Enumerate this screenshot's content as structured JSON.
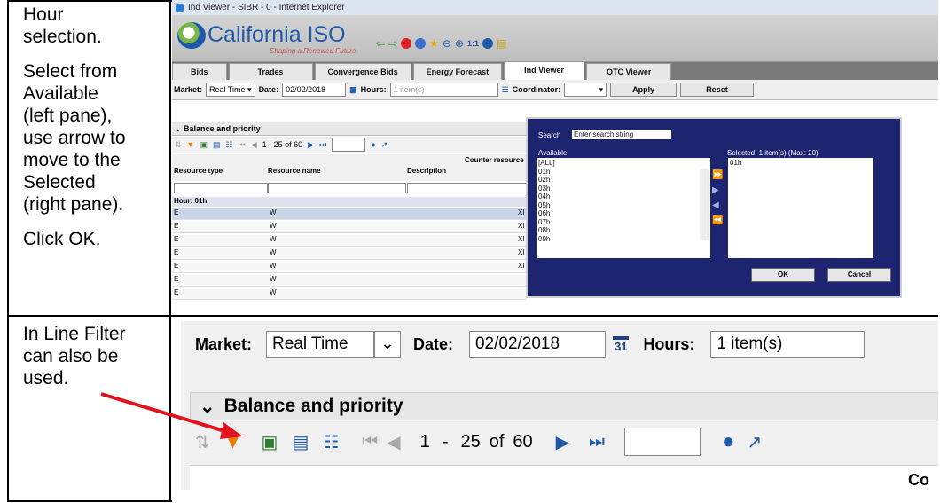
{
  "rows": [
    {
      "lines": [
        "Hour",
        "selection."
      ],
      "paragraphs": [
        [
          "Hour",
          "selection."
        ],
        [
          "Select from",
          "Available",
          "(left pane),",
          "use arrow to",
          "move to the",
          "Selected",
          "(right pane)."
        ],
        [
          "Click OK."
        ]
      ]
    },
    {
      "lines": [
        "In Line Filter",
        "can also be",
        "used."
      ]
    }
  ],
  "screenshot1": {
    "window_title": "Ind Viewer - SIBR - 0 - Internet Explorer",
    "brand_name": "California ISO",
    "brand_tagline": "Shaping a Renewed Future",
    "zoom_label": "1:1",
    "tabs": [
      "Bids",
      "Trades",
      "Convergence Bids",
      "Energy Forecast",
      "Ind Viewer",
      "OTC Viewer"
    ],
    "active_tab": "Ind Viewer",
    "filters": {
      "market_label": "Market:",
      "market_value": "Real Time",
      "date_label": "Date:",
      "date_value": "02/02/2018",
      "hours_label": "Hours:",
      "hours_value": "1 item(s)",
      "coordinator_label": "Coordinator:",
      "apply": "Apply",
      "reset": "Reset"
    },
    "section_title": "Balance and priority",
    "pager": {
      "range": "1 - 25 of 60"
    },
    "grid": {
      "counter_header": "Counter resource",
      "columns": [
        "Resource type",
        "Resource name",
        "Description"
      ],
      "group_label": "Hour: 01h",
      "rows": [
        {
          "type": "E",
          "name": "W",
          "desc": "XI"
        },
        {
          "type": "E",
          "name": "W",
          "desc": "XI"
        },
        {
          "type": "E",
          "name": "W",
          "desc": "XI"
        },
        {
          "type": "E",
          "name": "W",
          "desc": "XI"
        },
        {
          "type": "E",
          "name": "W",
          "desc": "XI"
        },
        {
          "type": "E",
          "name": "W",
          "desc": ""
        },
        {
          "type": "E",
          "name": "W",
          "desc": ""
        }
      ]
    },
    "popup": {
      "search_label": "Search",
      "search_placeholder": "Enter search string",
      "available_label": "Available",
      "selected_label": "Selected: 1 item(s) (Max: 20)",
      "available_items": [
        "[ALL]",
        "01h",
        "02h",
        "03h",
        "04h",
        "05h",
        "06h",
        "07h",
        "08h",
        "09h"
      ],
      "selected_items": [
        "01h"
      ],
      "ok": "OK",
      "cancel": "Cancel"
    }
  },
  "screenshot2": {
    "market_label": "Market:",
    "market_value": "Real Time",
    "date_label": "Date:",
    "date_value": "02/02/2018",
    "calendar_day": "31",
    "hours_label": "Hours:",
    "hours_value": "1 item(s)",
    "section_title": "Balance and priority",
    "pager_first": "1",
    "pager_dash": "-",
    "pager_count": "25",
    "pager_of": "of",
    "pager_total": "60",
    "grid_partial": "Co"
  },
  "colors": {
    "popup_bg": "#1d2470",
    "arrow": "#e0141e",
    "filter_icon": "#f07a00",
    "brand": "#1e5aa8"
  }
}
